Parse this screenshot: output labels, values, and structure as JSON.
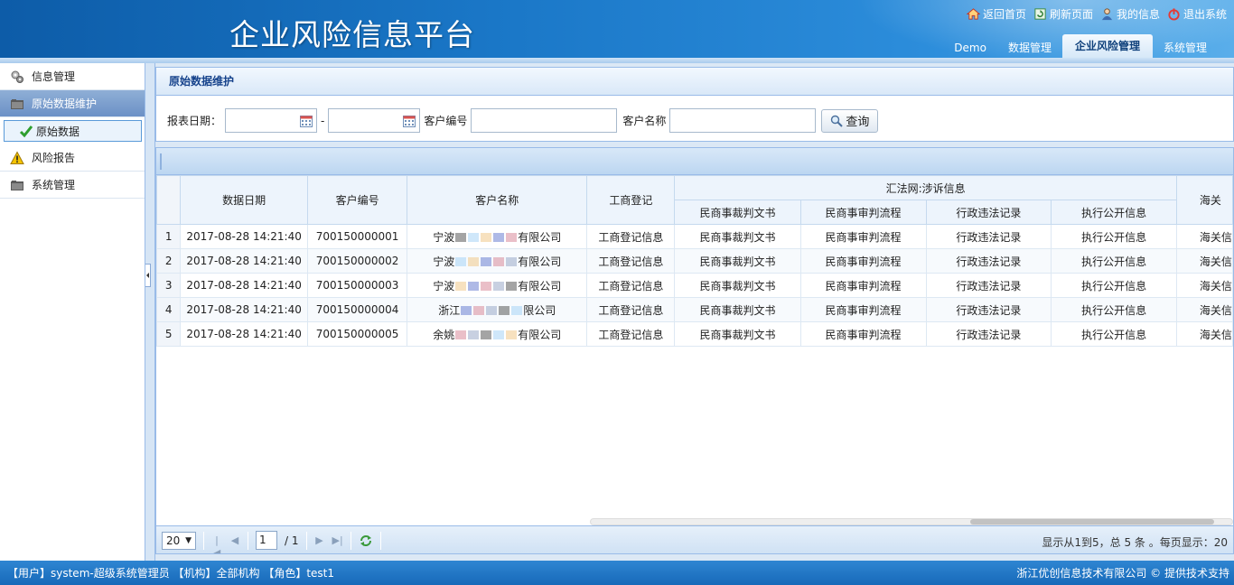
{
  "header": {
    "title": "企业风险信息平台",
    "links": [
      {
        "label": "返回首页",
        "icon": "home-icon"
      },
      {
        "label": "刷新页面",
        "icon": "refresh-page-icon"
      },
      {
        "label": "我的信息",
        "icon": "user-icon"
      },
      {
        "label": "退出系统",
        "icon": "power-icon"
      }
    ],
    "tabs": [
      "Demo",
      "数据管理",
      "企业风险管理",
      "系统管理"
    ],
    "active_tab": "企业风险管理"
  },
  "sidebar": {
    "items": [
      {
        "label": "信息管理",
        "icon": "gears-icon"
      },
      {
        "label": "原始数据维护",
        "icon": "folder-icon",
        "active": true
      },
      {
        "label": "风险报告",
        "icon": "warning-icon"
      },
      {
        "label": "系统管理",
        "icon": "folder-icon"
      }
    ],
    "sub_item": {
      "label": "原始数据",
      "icon": "checkmark-icon"
    }
  },
  "panel": {
    "title": "原始数据维护",
    "filters": {
      "report_date_label": "报表日期：",
      "date_from": "",
      "date_sep": "-",
      "date_to": "",
      "customer_no_label": "客户编号",
      "customer_no_value": "",
      "customer_name_label": "客户名称",
      "customer_name_value": "",
      "search_label": "查询"
    }
  },
  "grid": {
    "columns": {
      "data_date": "数据日期",
      "customer_no": "客户编号",
      "customer_name": "客户名称",
      "business_reg": "工商登记",
      "group_header": "汇法网:涉诉信息",
      "sub": [
        "民商事裁判文书",
        "民商事审判流程",
        "行政违法记录",
        "执行公开信息"
      ],
      "customs": "海关"
    },
    "rows": [
      {
        "n": "1",
        "date": "2017-08-28 14:21:40",
        "no": "700150000001",
        "name_pre": "宁波",
        "name_post": "有限公司",
        "reg": "工商登记信息",
        "c1": "民商事裁判文书",
        "c2": "民商事审判流程",
        "c3": "行政违法记录",
        "c4": "执行公开信息",
        "c5": "海关信"
      },
      {
        "n": "2",
        "date": "2017-08-28 14:21:40",
        "no": "700150000002",
        "name_pre": "宁波",
        "name_post": "有限公司",
        "reg": "工商登记信息",
        "c1": "民商事裁判文书",
        "c2": "民商事审判流程",
        "c3": "行政违法记录",
        "c4": "执行公开信息",
        "c5": "海关信"
      },
      {
        "n": "3",
        "date": "2017-08-28 14:21:40",
        "no": "700150000003",
        "name_pre": "宁波",
        "name_post": "有限公司",
        "reg": "工商登记信息",
        "c1": "民商事裁判文书",
        "c2": "民商事审判流程",
        "c3": "行政违法记录",
        "c4": "执行公开信息",
        "c5": "海关信"
      },
      {
        "n": "4",
        "date": "2017-08-28 14:21:40",
        "no": "700150000004",
        "name_pre": "浙江",
        "name_post": "限公司",
        "reg": "工商登记信息",
        "c1": "民商事裁判文书",
        "c2": "民商事审判流程",
        "c3": "行政违法记录",
        "c4": "执行公开信息",
        "c5": "海关信"
      },
      {
        "n": "5",
        "date": "2017-08-28 14:21:40",
        "no": "700150000005",
        "name_pre": "余姚",
        "name_post": "有限公司",
        "reg": "工商登记信息",
        "c1": "民商事裁判文书",
        "c2": "民商事审判流程",
        "c3": "行政违法记录",
        "c4": "执行公开信息",
        "c5": "海关信"
      }
    ]
  },
  "pager": {
    "page_size": "20",
    "current_page": "1",
    "total_pages": "/ 1",
    "info": "显示从1到5，总 5 条 。每页显示：20"
  },
  "footer": {
    "left": "【用户】system-超级系统管理员 【机构】全部机构 【角色】test1",
    "right": "浙江优创信息技术有限公司 © 提供技术支持"
  },
  "colors": {
    "header_blue": "#1a77c7",
    "sidebar_active": "#7b9dcc",
    "grid_border": "#99bbe8",
    "panel_title_text": "#15428b"
  }
}
